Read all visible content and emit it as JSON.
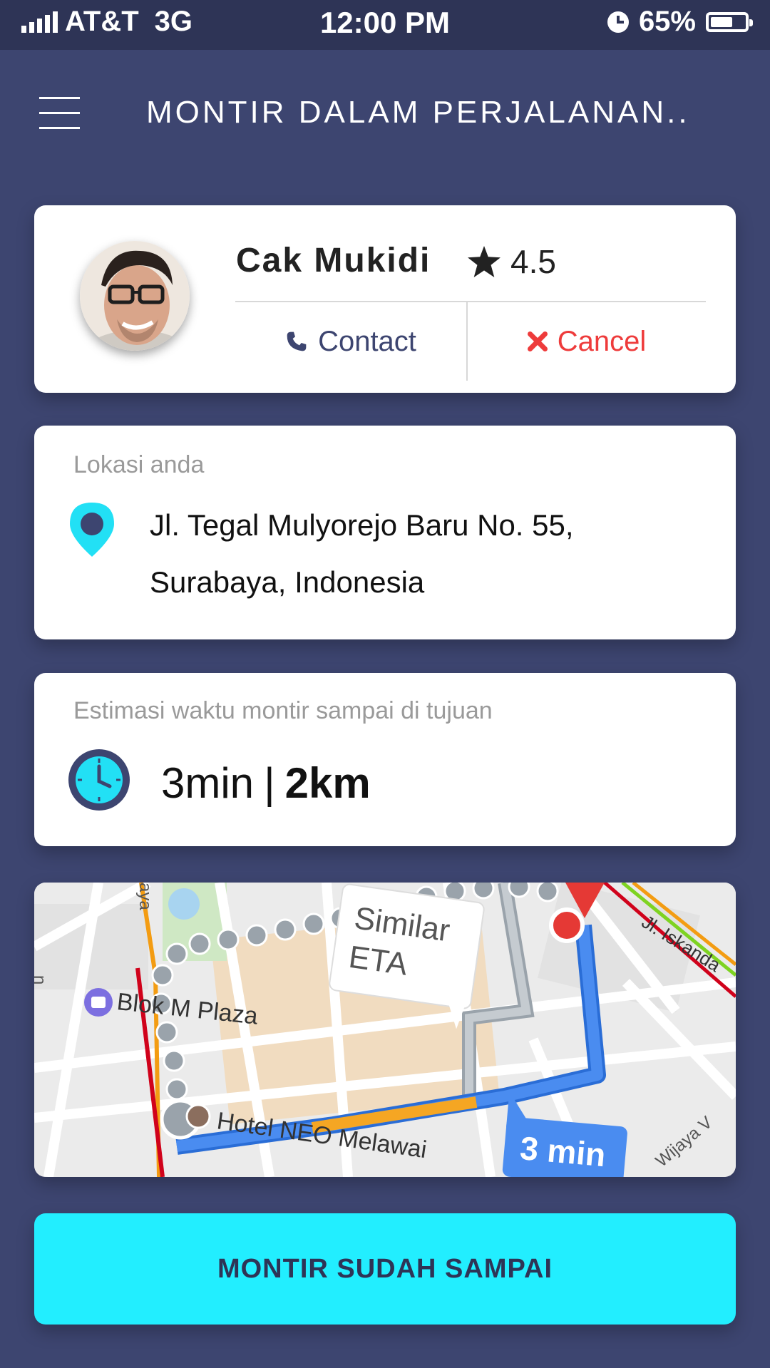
{
  "status_bar": {
    "carrier": "AT&T",
    "network": "3G",
    "time": "12:00 PM",
    "battery": "65%",
    "battery_level": 0.65
  },
  "header": {
    "title": "MONTIR DALAM PERJALANAN.."
  },
  "driver": {
    "name": "Cak Mukidi",
    "rating": "4.5",
    "contact_label": "Contact",
    "cancel_label": "Cancel"
  },
  "location": {
    "label": "Lokasi anda",
    "address_line1": "Jl. Tegal Mulyorejo Baru No. 55,",
    "address_line2": "Surabaya, Indonesia"
  },
  "eta": {
    "label": "Estimasi waktu montir sampai di tujuan",
    "time": "3min",
    "separator": "|",
    "distance": "2km"
  },
  "map": {
    "labels": {
      "plaza": "Blok M Plaza",
      "hotel": "Hotel NEO Melawai",
      "street1": "Jl. Iskanda",
      "street2": "Wijaya V",
      "street3": "aya",
      "street4": "n",
      "similar_eta": "Similar ETA",
      "similar_eta_line1": "Similar",
      "similar_eta_line2": "ETA",
      "route_time": "3 min"
    }
  },
  "actions": {
    "arrived_label": "MONTIR SUDAH SAMPAI"
  },
  "colors": {
    "background": "#3d4570",
    "accent": "#22eeff",
    "cancel": "#ee3b3b",
    "route": "#4a8cf0"
  }
}
